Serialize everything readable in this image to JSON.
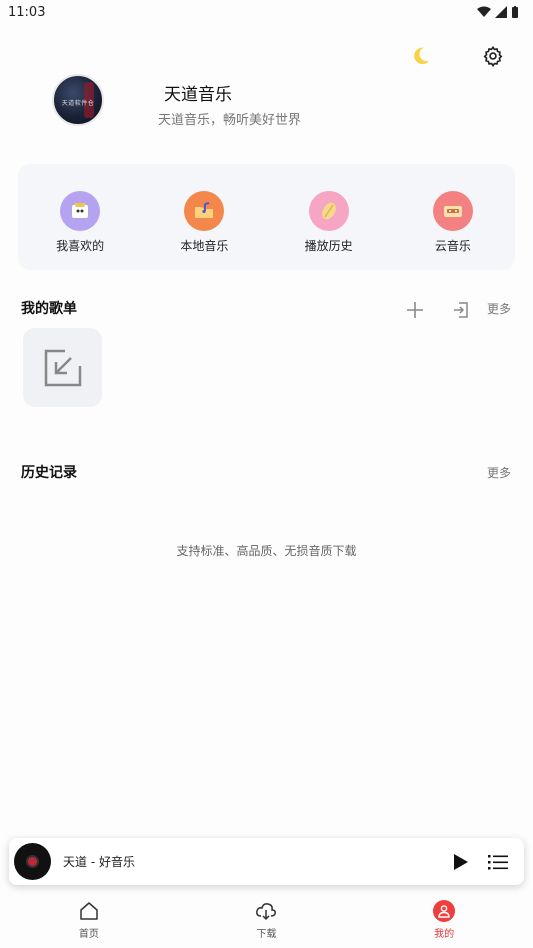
{
  "status_bar": {
    "time": "11:03"
  },
  "profile": {
    "name": "天道音乐",
    "subtitle": "天道音乐，畅听美好世界",
    "avatar_caption": "天道软件仓"
  },
  "quick_access": [
    {
      "label": "我喜欢的",
      "icon": "favorites-icon",
      "color": "#b5a3f2"
    },
    {
      "label": "本地音乐",
      "icon": "local-music-icon",
      "color": "#f4874b"
    },
    {
      "label": "播放历史",
      "icon": "history-disc-icon",
      "color": "#f6a5c3"
    },
    {
      "label": "云音乐",
      "icon": "cloud-cassette-icon",
      "color": "#f38181"
    }
  ],
  "my_playlists": {
    "title": "我的歌单",
    "more": "更多"
  },
  "history": {
    "title": "历史记录",
    "more": "更多",
    "empty_hint": "支持标准、高品质、无损音质下载"
  },
  "mini_player": {
    "track": "天道 - 好音乐"
  },
  "tabs": [
    {
      "label": "首页",
      "icon": "home-icon",
      "active": false
    },
    {
      "label": "下载",
      "icon": "cloud-download-icon",
      "active": false
    },
    {
      "label": "我的",
      "icon": "user-icon",
      "active": true
    }
  ],
  "colors": {
    "accent": "#ef3e3e",
    "card_bg": "#f5f6fa",
    "moon": "#f7d34a"
  }
}
